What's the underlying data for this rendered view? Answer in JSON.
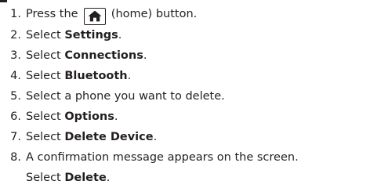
{
  "steps": [
    {
      "num": "1.",
      "pre": "Press the",
      "post": "(home) button.",
      "icon": "home-icon"
    },
    {
      "num": "2.",
      "pre": "Select ",
      "bold": "Settings",
      "post": "."
    },
    {
      "num": "3.",
      "pre": "Select ",
      "bold": "Connections",
      "post": "."
    },
    {
      "num": "4.",
      "pre": "Select ",
      "bold": "Bluetooth",
      "post": "."
    },
    {
      "num": "5.",
      "text": "Select a phone you want to delete."
    },
    {
      "num": "6.",
      "pre": "Select ",
      "bold": "Options",
      "post": "."
    },
    {
      "num": "7.",
      "pre": "Select ",
      "bold": "Delete Device",
      "post": "."
    },
    {
      "num": "8.",
      "text": "A confirmation message appears on the screen.",
      "cont_pre": "Select ",
      "cont_bold": "Delete",
      "cont_post": "."
    }
  ]
}
